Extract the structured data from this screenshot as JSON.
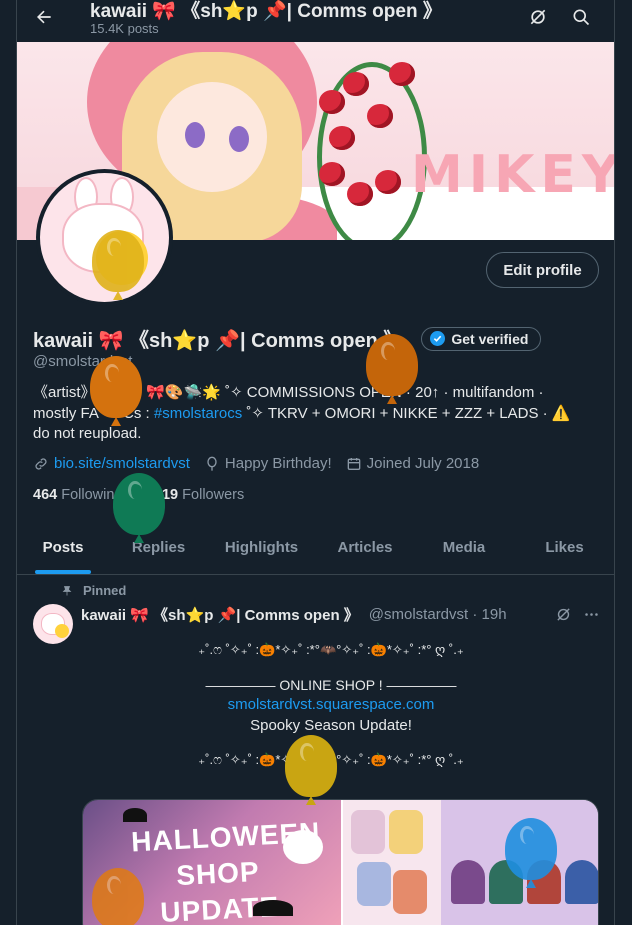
{
  "header": {
    "title": "kawaii 🎀 《sh⭐p 📌| Comms open 》",
    "post_count": "15.4K posts"
  },
  "banner": {
    "text": "MIKEY"
  },
  "profile": {
    "edit_label": "Edit profile",
    "display_name": "kawaii 🎀 《sh⭐p 📌| Comms open 》",
    "verify_label": "Get verified",
    "handle": "@smolstardvst",
    "bio_line1": "《artist》ʚ ˖⁺ ☆. 🎀🎨🛸🌟 ˚✧ COMMISSIONS OPEN · 20↑ · multifandom ·",
    "bio_line2_pre": "mostly FA · OCs : ",
    "bio_hashtag": "#smolstarocs",
    "bio_line2_post": " ˚✧ TKRV + OMORI + NIKKE + ZZZ + LADS · ⚠️",
    "bio_line3": "do not reupload.",
    "link": "bio.site/smolstardvst",
    "birthday": "Happy Birthday!",
    "joined": "Joined July 2018",
    "following_count": "464",
    "following_label": "Following",
    "followers_count": "1,119",
    "followers_label": "Followers"
  },
  "tabs": [
    {
      "label": "Posts"
    },
    {
      "label": "Replies"
    },
    {
      "label": "Highlights"
    },
    {
      "label": "Articles"
    },
    {
      "label": "Media"
    },
    {
      "label": "Likes"
    }
  ],
  "tweet": {
    "pinned_label": "Pinned",
    "name": "kawaii 🎀 《sh⭐p 📌| Comms open 》",
    "handle_time": "@smolstardvst · 19h",
    "lines": [
      "₊˚.ෆ ˚✧₊˚ :🎃*✧₊˚ :*°🦇°✧₊˚ :🎃*✧₊˚ :*° ღ ˚.₊",
      "————— ONLINE SHOP ! —————",
      "smolstardvst.squarespace.com",
      "Spooky Season Update!",
      "₊˚.ෆ ˚✧₊˚ :🎃*✧₊˚ :*°🦇°✧₊˚ :🎃*✧₊˚ :*° ღ ˚.₊"
    ],
    "media_title": "HALLOWEEN SHOP UPDATE"
  },
  "colors": {
    "background": "#15202b",
    "accent": "#1d9bf0",
    "text": "#e7e9ea",
    "muted": "#8b98a5",
    "border": "#38444d"
  },
  "icons": [
    "back-arrow-icon",
    "grok-icon",
    "search-icon",
    "verified-badge-icon",
    "link-icon",
    "balloon-icon",
    "calendar-icon",
    "pin-icon",
    "more-icon"
  ]
}
